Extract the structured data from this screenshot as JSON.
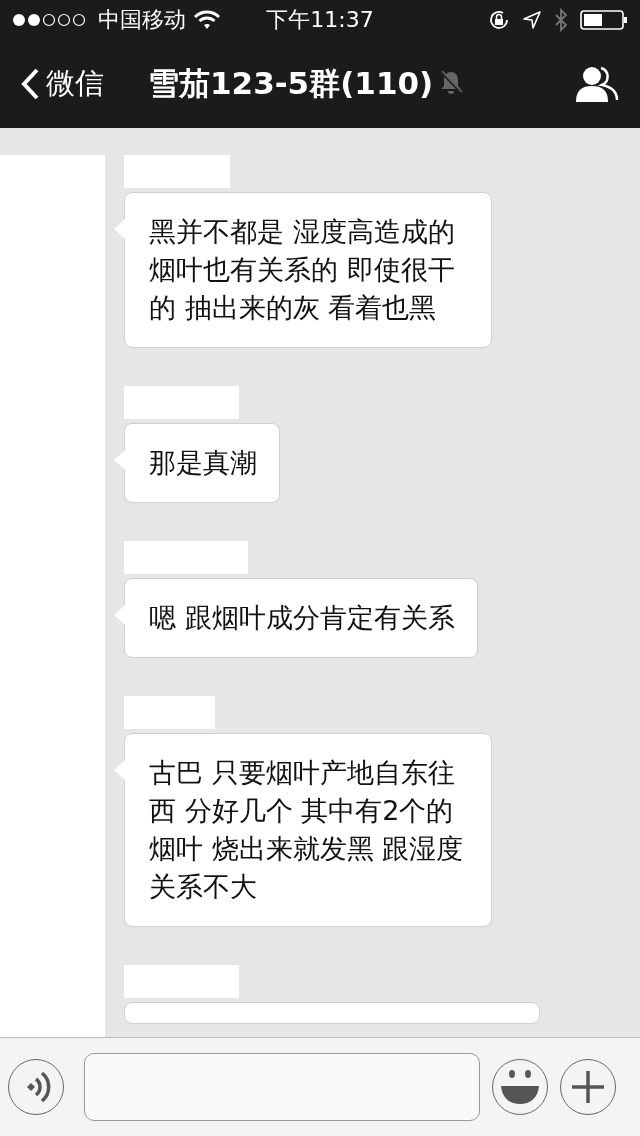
{
  "status_bar": {
    "carrier": "中国移动",
    "time": "下午11:37"
  },
  "nav_bar": {
    "back_label": "微信",
    "title": "雪茄123-5群(110)",
    "muted": true
  },
  "messages": [
    {
      "kind": "text",
      "text": "黑并不都是 湿度高造成的烟叶也有关系的 即使很干的 抽出来的灰 看着也黑"
    },
    {
      "kind": "text",
      "text": "那是真潮"
    },
    {
      "kind": "text",
      "text": "嗯 跟烟叶成分肯定有关系"
    },
    {
      "kind": "text",
      "text": "古巴 只要烟叶产地自东往西 分好几个 其中有2个的烟叶 烧出来就发黑 跟湿度关系不大"
    },
    {
      "kind": "cut"
    }
  ]
}
